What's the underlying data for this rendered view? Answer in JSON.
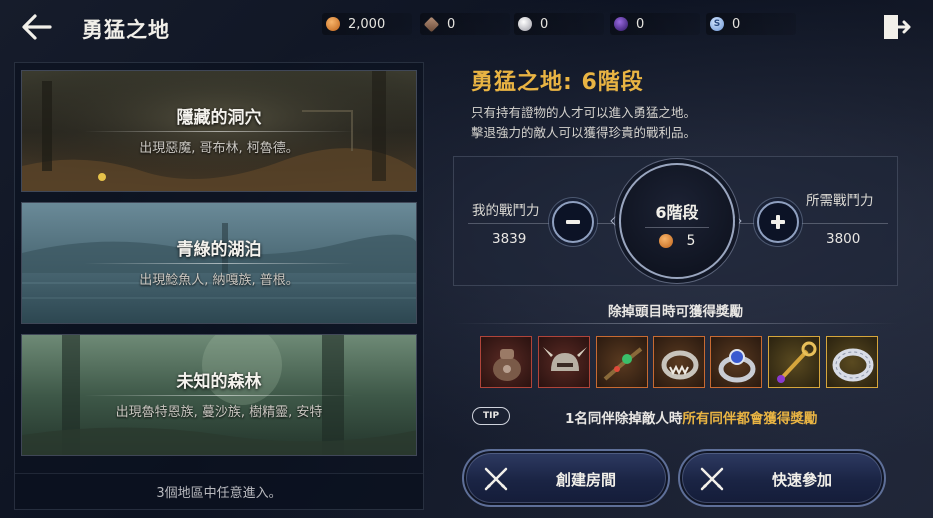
{
  "header": {
    "title": "勇猛之地",
    "back_icon": "arrow-left-icon",
    "exit_icon": "exit-door-icon"
  },
  "currencies": [
    {
      "icon": "orange-coin-icon",
      "color": "#d9822b",
      "value": "2,000"
    },
    {
      "icon": "brown-gem-icon",
      "color": "#8a6a55",
      "value": "0"
    },
    {
      "icon": "silver-orb-icon",
      "color": "#c9c9cf",
      "value": "0"
    },
    {
      "icon": "purple-orb-icon",
      "color": "#4a2a8a",
      "value": "0"
    },
    {
      "icon": "blue-s-coin-icon",
      "color": "#8fb4e6",
      "value": "0"
    }
  ],
  "areas": [
    {
      "name": "隱藏的洞穴",
      "desc": "出現惡魔, 哥布林, 柯魯德。"
    },
    {
      "name": "青綠的湖泊",
      "desc": "出現鯰魚人, 納嘎族, 普根。"
    },
    {
      "name": "未知的森林",
      "desc": "出現魯特恩族, 蔓沙族, 樹精靈, 安特"
    }
  ],
  "areas_footer": "3個地區中任意進入。",
  "stage": {
    "title": "勇猛之地: 6階段",
    "desc_line1": "只有持有證物的人才可以進入勇猛之地。",
    "desc_line2": "擊退強力的敵人可以獲得珍貴的戰利品。",
    "my_power_label": "我的戰鬥力",
    "my_power_value": "3839",
    "required_power_label": "所需戰鬥力",
    "required_power_value": "3800",
    "level": "6階段",
    "cost": "5",
    "minus_icon": "minus-icon",
    "plus_icon": "plus-icon"
  },
  "rewards": {
    "title": "除掉頭目時可獲得獎勵",
    "items": [
      {
        "icon": "pouch-item-icon",
        "border": "#b0443a"
      },
      {
        "icon": "horned-helmet-icon",
        "border": "#b0443a"
      },
      {
        "icon": "emerald-branch-icon",
        "border": "#c86a32"
      },
      {
        "icon": "fanged-ring-icon",
        "border": "#c86a32"
      },
      {
        "icon": "sapphire-ring-icon",
        "border": "#c86a32"
      },
      {
        "icon": "golden-scepter-icon",
        "border": "#d6a63c"
      },
      {
        "icon": "silver-band-icon",
        "border": "#d6a63c"
      }
    ]
  },
  "tip": {
    "badge": "TIP",
    "text_plain": "1名同伴除掉敵人時",
    "text_highlight": "所有同伴都會獲得獎勵"
  },
  "buttons": {
    "create_room": "創建房間",
    "quick_join": "快速參加"
  }
}
